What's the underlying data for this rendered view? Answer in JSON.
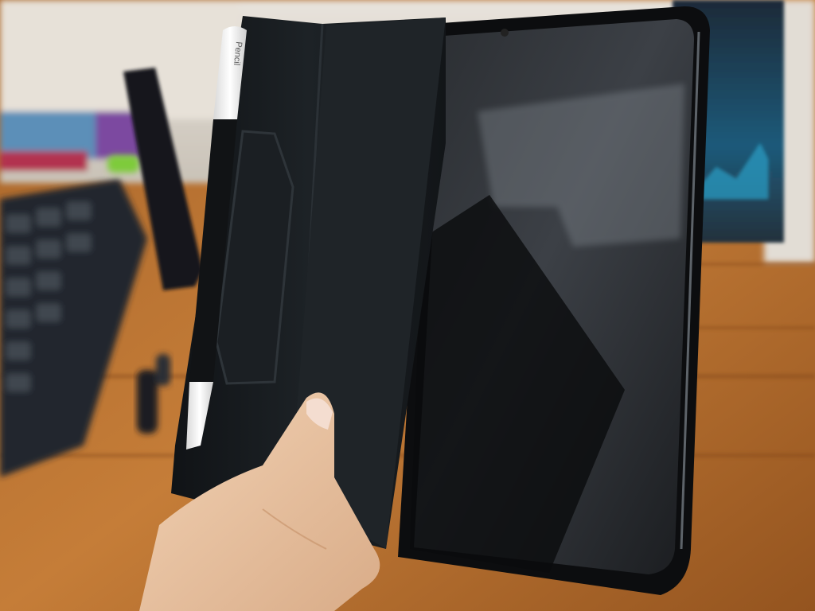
{
  "photo": {
    "pencil_brand_text": "Pencil",
    "colors": {
      "desk_wood": "#b0702f",
      "wall": "#d9d4cc",
      "case_black": "#15181b",
      "tablet_screen": "#141619",
      "pencil_white": "#f1f1f1",
      "skin": "#e9c6a6",
      "keyboard_dark": "#22272d",
      "monitor_glow": "#2aa0c8"
    }
  }
}
